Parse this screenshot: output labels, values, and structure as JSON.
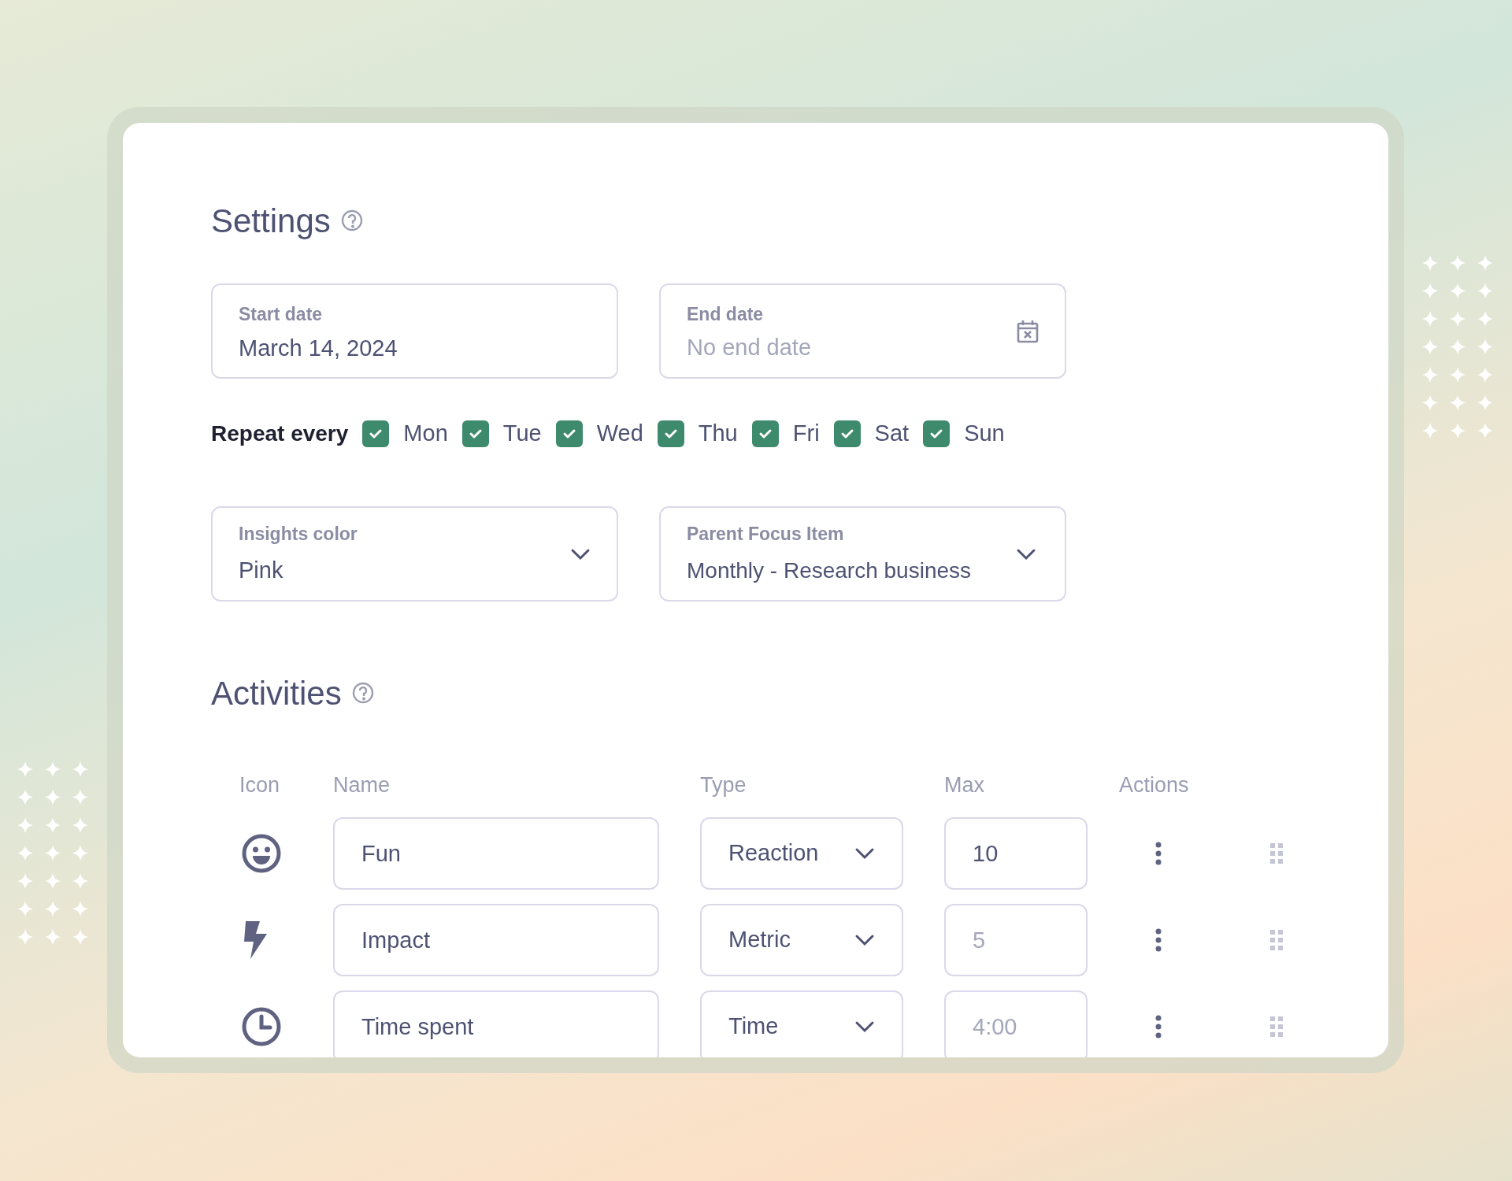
{
  "settings": {
    "title": "Settings",
    "start_date": {
      "label": "Start date",
      "value": "March 14, 2024"
    },
    "end_date": {
      "label": "End date",
      "placeholder": "No end date"
    },
    "repeat": {
      "label": "Repeat every",
      "days": [
        {
          "label": "Mon",
          "checked": true
        },
        {
          "label": "Tue",
          "checked": true
        },
        {
          "label": "Wed",
          "checked": true
        },
        {
          "label": "Thu",
          "checked": true
        },
        {
          "label": "Fri",
          "checked": true
        },
        {
          "label": "Sat",
          "checked": true
        },
        {
          "label": "Sun",
          "checked": true
        }
      ]
    },
    "insights_color": {
      "label": "Insights color",
      "value": "Pink"
    },
    "parent_focus_item": {
      "label": "Parent Focus Item",
      "value": "Monthly - Research business"
    }
  },
  "activities": {
    "title": "Activities",
    "columns": [
      "Icon",
      "Name",
      "Type",
      "Max",
      "Actions"
    ],
    "rows": [
      {
        "kind": "reaction",
        "name": "Fun",
        "type": "Reaction",
        "max": {
          "value": "10"
        }
      },
      {
        "kind": "metric",
        "name": "Impact",
        "type": "Metric",
        "max": {
          "placeholder": "5"
        }
      },
      {
        "kind": "time",
        "name": "Time spent",
        "type": "Time",
        "max": {
          "placeholder": "4:00"
        }
      }
    ]
  }
}
